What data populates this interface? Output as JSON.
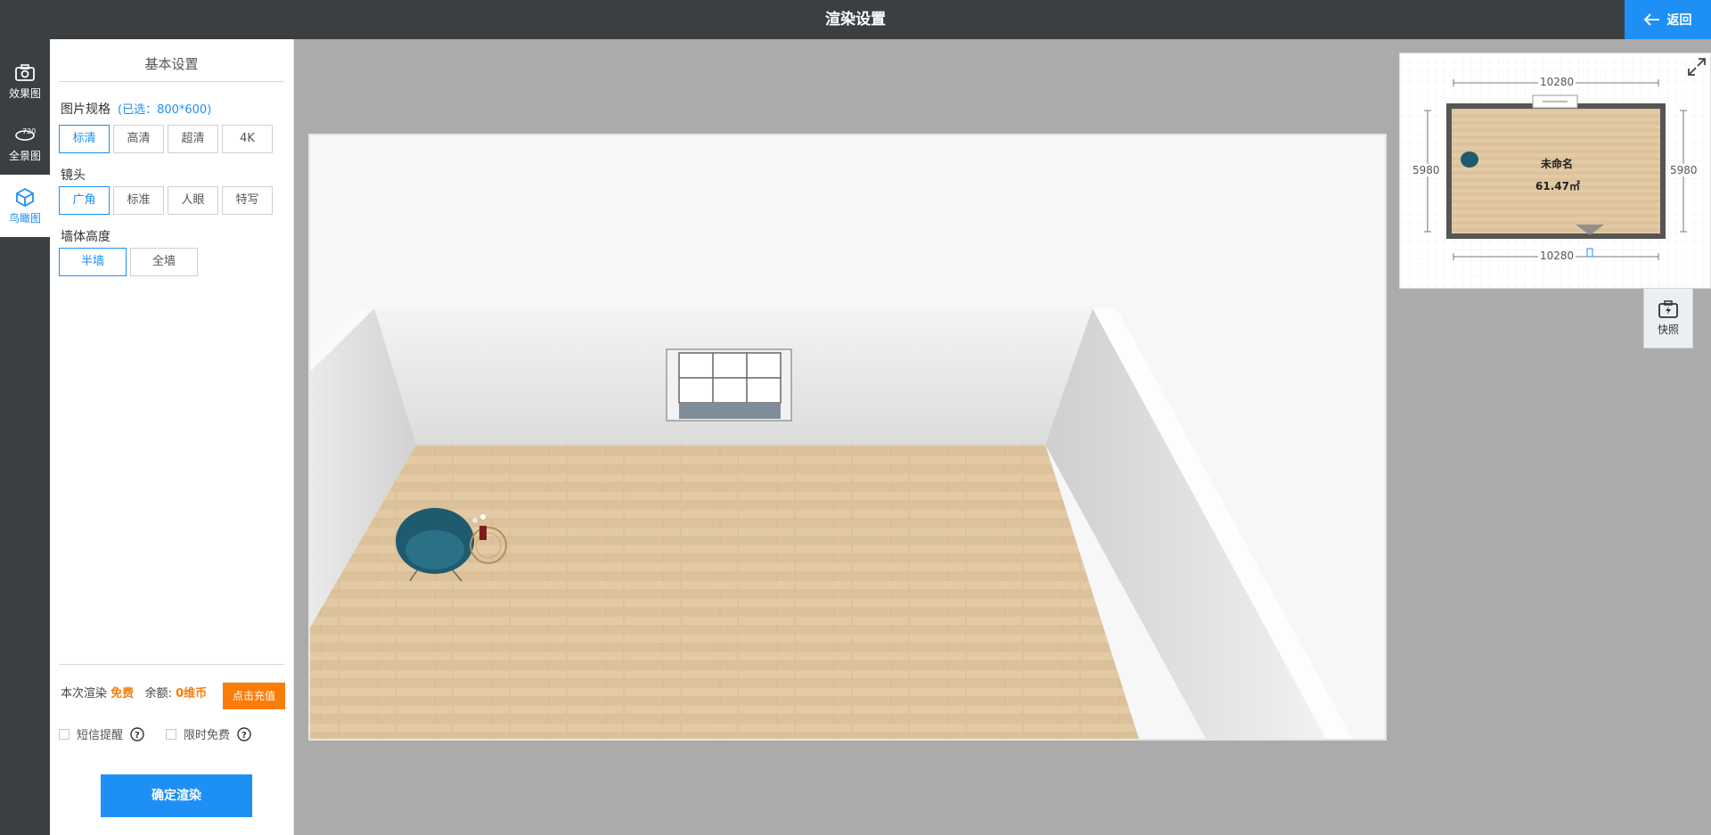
{
  "header": {
    "title": "渲染设置",
    "back_label": "返回"
  },
  "rail": {
    "items": [
      {
        "label": "效果图",
        "icon": "camera-icon",
        "active": false
      },
      {
        "label": "全景图",
        "icon": "panorama-720-icon",
        "active": false
      },
      {
        "label": "鸟瞰图",
        "icon": "cube-icon",
        "active": true
      }
    ]
  },
  "panel": {
    "title": "基本设置",
    "resolution": {
      "label": "图片规格",
      "note": "(已选：800*600)",
      "options": [
        "标清",
        "高清",
        "超清",
        "4K"
      ],
      "selected": "标清"
    },
    "lens": {
      "label": "镜头",
      "options": [
        "广角",
        "标准",
        "人眼",
        "特写"
      ],
      "selected": "广角"
    },
    "wall_height": {
      "label": "墙体高度",
      "options": [
        "半墙",
        "全墙"
      ],
      "selected": "半墙"
    },
    "cost": {
      "render_label": "本次渲染",
      "render_value": "免费",
      "balance_label": "余额:",
      "balance_value": "0维币"
    },
    "recharge_label": "点击充值",
    "sms_label": "短信提醒",
    "limited_free_label": "限时免费",
    "confirm_label": "确定渲染"
  },
  "minimap": {
    "width_dim": "10280",
    "height_dim": "5980",
    "room_name": "未命名",
    "room_area": "61.47㎡"
  },
  "snapshot_label": "快照",
  "colors": {
    "accent": "#1e8ff5",
    "orange": "#fa7d0a",
    "dark": "#3c3f42"
  }
}
